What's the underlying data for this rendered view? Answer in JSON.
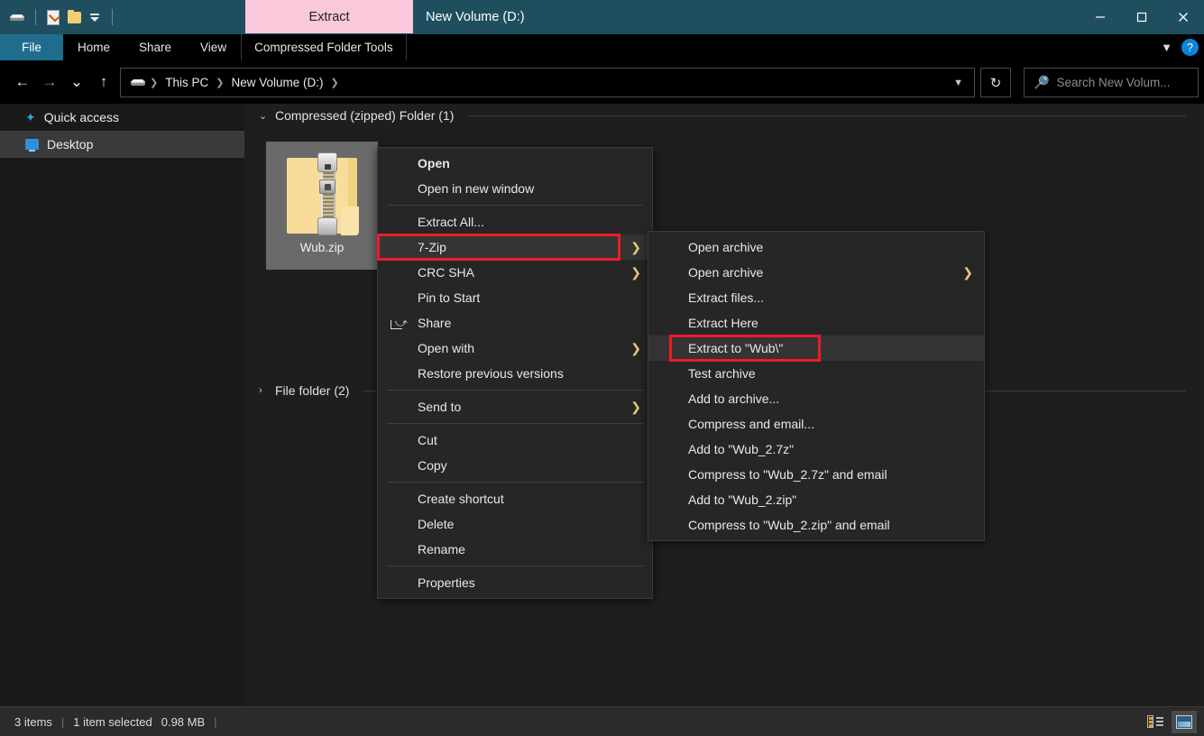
{
  "window": {
    "title": "New Volume (D:)",
    "contextual_tab": "Extract",
    "quick_access_icons": [
      "drive-icon",
      "properties-icon",
      "new-folder-icon",
      "customize-dropdown-icon"
    ],
    "controls": {
      "minimize": "–",
      "maximize": "□",
      "close": "✕"
    }
  },
  "ribbon": {
    "tabs": [
      {
        "label": "File",
        "id": "file"
      },
      {
        "label": "Home",
        "id": "home"
      },
      {
        "label": "Share",
        "id": "share"
      },
      {
        "label": "View",
        "id": "view"
      },
      {
        "label": "Compressed Folder Tools",
        "id": "compressed-folder-tools"
      }
    ],
    "expand_icon": "chevron-down-icon",
    "help_label": "?"
  },
  "nav": {
    "back": "←",
    "forward": "→",
    "recent": "⌄",
    "up": "↑",
    "breadcrumbs": [
      {
        "label": "This PC"
      },
      {
        "label": "New Volume (D:)"
      }
    ],
    "dropdown_icon": "chevron-down-icon",
    "refresh_icon": "refresh-icon",
    "refresh_glyph": "↻"
  },
  "search": {
    "placeholder": "Search New Volum...",
    "icon": "search-icon"
  },
  "sidebar": {
    "items": [
      {
        "label": "Quick access",
        "icon": "star-icon",
        "selected": false
      },
      {
        "label": "Desktop",
        "icon": "monitor-icon",
        "selected": true
      }
    ]
  },
  "content": {
    "groups": [
      {
        "label": "Compressed (zipped) Folder (1)",
        "chevron": "⌄"
      },
      {
        "label": "File folder (2)",
        "chevron": "›"
      }
    ],
    "files": [
      {
        "name": "Wub.zip",
        "icon": "zip-folder-icon",
        "selected": true
      }
    ]
  },
  "context_menu": {
    "items": [
      {
        "label": "Open",
        "bold": true,
        "submenu": false
      },
      {
        "label": "Open in new window",
        "bold": false,
        "submenu": false
      },
      {
        "separator": true
      },
      {
        "label": "Extract All...",
        "bold": false,
        "submenu": false
      },
      {
        "label": "7-Zip",
        "bold": false,
        "submenu": true,
        "highlighted": true,
        "annotated": true
      },
      {
        "label": "CRC SHA",
        "bold": false,
        "submenu": true
      },
      {
        "label": "Pin to Start",
        "bold": false,
        "submenu": false
      },
      {
        "label": "Share",
        "bold": false,
        "submenu": false,
        "icon": "share-icon"
      },
      {
        "label": "Open with",
        "bold": false,
        "submenu": true
      },
      {
        "label": "Restore previous versions",
        "bold": false,
        "submenu": false
      },
      {
        "separator": true
      },
      {
        "label": "Send to",
        "bold": false,
        "submenu": true
      },
      {
        "separator": true
      },
      {
        "label": "Cut",
        "bold": false,
        "submenu": false
      },
      {
        "label": "Copy",
        "bold": false,
        "submenu": false
      },
      {
        "separator": true
      },
      {
        "label": "Create shortcut",
        "bold": false,
        "submenu": false
      },
      {
        "label": "Delete",
        "bold": false,
        "submenu": false
      },
      {
        "label": "Rename",
        "bold": false,
        "submenu": false
      },
      {
        "separator": true
      },
      {
        "label": "Properties",
        "bold": false,
        "submenu": false
      }
    ]
  },
  "submenu_7zip": {
    "items": [
      {
        "label": "Open archive",
        "submenu": false
      },
      {
        "label": "Open archive",
        "submenu": true
      },
      {
        "label": "Extract files...",
        "submenu": false
      },
      {
        "label": "Extract Here",
        "submenu": false
      },
      {
        "label": "Extract to \"Wub\\\"",
        "submenu": false,
        "highlighted": true,
        "annotated": true
      },
      {
        "label": "Test archive",
        "submenu": false
      },
      {
        "label": "Add to archive...",
        "submenu": false
      },
      {
        "label": "Compress and email...",
        "submenu": false
      },
      {
        "label": "Add to \"Wub_2.7z\"",
        "submenu": false
      },
      {
        "label": "Compress to \"Wub_2.7z\" and email",
        "submenu": false
      },
      {
        "label": "Add to \"Wub_2.zip\"",
        "submenu": false
      },
      {
        "label": "Compress to \"Wub_2.zip\" and email",
        "submenu": false
      }
    ]
  },
  "status": {
    "item_count": "3 items",
    "selection": "1 item selected",
    "size": "0.98 MB",
    "view_buttons": [
      {
        "name": "details-view",
        "active": false
      },
      {
        "name": "large-icons-view",
        "active": true
      }
    ]
  },
  "colors": {
    "titlebar": "#1f4e5f",
    "contextual_tab": "#f9c8da",
    "file_tab": "#1f6c8c",
    "annotation": "#ee1c25",
    "menu_bg": "#262626",
    "content_bg": "#1e1e1e",
    "accent_blue": "#0a84d8"
  }
}
